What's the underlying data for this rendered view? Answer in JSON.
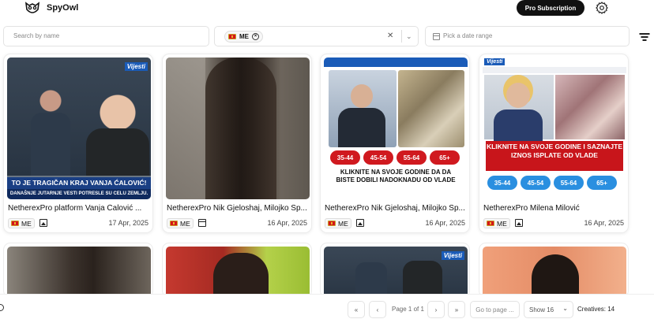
{
  "app": {
    "brand": "SpyOwl",
    "pro_label": "Pro Subscription"
  },
  "filters": {
    "search_placeholder": "Search by name",
    "country_chip": "ME",
    "date_placeholder": "Pick a date range"
  },
  "cards": [
    {
      "title": "NetherexPro platform Vanja Ćalović ...",
      "country": "ME",
      "date": "17 Apr, 2025",
      "media": "image",
      "banner_main": "TO JE TRAGIČAN KRAJ  VANJA ĆALOVIĆ!",
      "banner_sub": "DANAŠNJE JUTARNJE VESTI POTRESLE SU CELU ZEMLJU.",
      "logo": "Vijesti"
    },
    {
      "title": "NetherexPro Nik Gjeloshaj, Milojko Sp...",
      "country": "ME",
      "date": "16 Apr, 2025",
      "media": "video"
    },
    {
      "title": "NetherexPro Nik Gjeloshaj, Milojko Sp...",
      "country": "ME",
      "date": "16 Apr, 2025",
      "media": "image",
      "headline": "KLIKNITE NA SVOJE GODINE DA DA BISTE DOBILI NADOKNADU OD VLADE",
      "ages": [
        "35-44",
        "45-54",
        "55-64",
        "65+"
      ]
    },
    {
      "title": "NetherexPro Milena Milović",
      "country": "ME",
      "date": "16 Apr, 2025",
      "media": "image",
      "logo": "Vijesti",
      "headline": "KLIKNITE NA SVOJE GODINE I SAZNAJTE IZNOS ISPLATE OD VLADE",
      "ages": [
        "35-44",
        "45-54",
        "55-64",
        "65+"
      ]
    }
  ],
  "second_row": [
    {
      "logo": "Vijesti"
    }
  ],
  "pagination": {
    "first": "«",
    "prev": "‹",
    "page_info": "Page 1 of 1",
    "next": "›",
    "last": "»",
    "goto_placeholder": "Go to page ...",
    "show_label": "Show 16",
    "creatives_label": "Creatives: 14"
  },
  "colors": {
    "accent": "#111111",
    "banner_blue": "#1a3f84",
    "age_red": "#d0191f",
    "age_blue": "#2a8fe0"
  }
}
